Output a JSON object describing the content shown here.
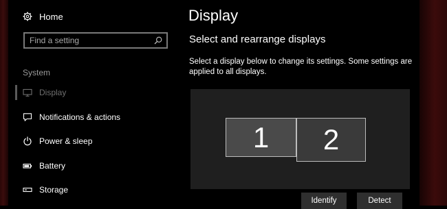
{
  "sidebar": {
    "home_label": "Home",
    "search_placeholder": "Find a setting",
    "section_label": "System",
    "items": [
      {
        "label": "Display",
        "icon": "monitor-icon",
        "selected": true
      },
      {
        "label": "Notifications & actions",
        "icon": "speech-bubble-icon",
        "selected": false
      },
      {
        "label": "Power & sleep",
        "icon": "power-icon",
        "selected": false
      },
      {
        "label": "Battery",
        "icon": "battery-icon",
        "selected": false
      },
      {
        "label": "Storage",
        "icon": "storage-icon",
        "selected": false
      }
    ]
  },
  "main": {
    "title": "Display",
    "subtitle": "Select and rearrange displays",
    "description": "Select a display below to change its settings. Some settings are applied to all displays.",
    "monitors": [
      {
        "label": "1",
        "selected": true
      },
      {
        "label": "2",
        "selected": false
      }
    ],
    "identify_label": "Identify",
    "detect_label": "Detect"
  },
  "colors": {
    "background": "#000000",
    "arrangement_area": "#1f1f1f",
    "selected_monitor": "#4a4a4a",
    "monitor": "#3a3a3a",
    "button": "#2f2f2f",
    "accent_edge": "#3a0c0c"
  }
}
